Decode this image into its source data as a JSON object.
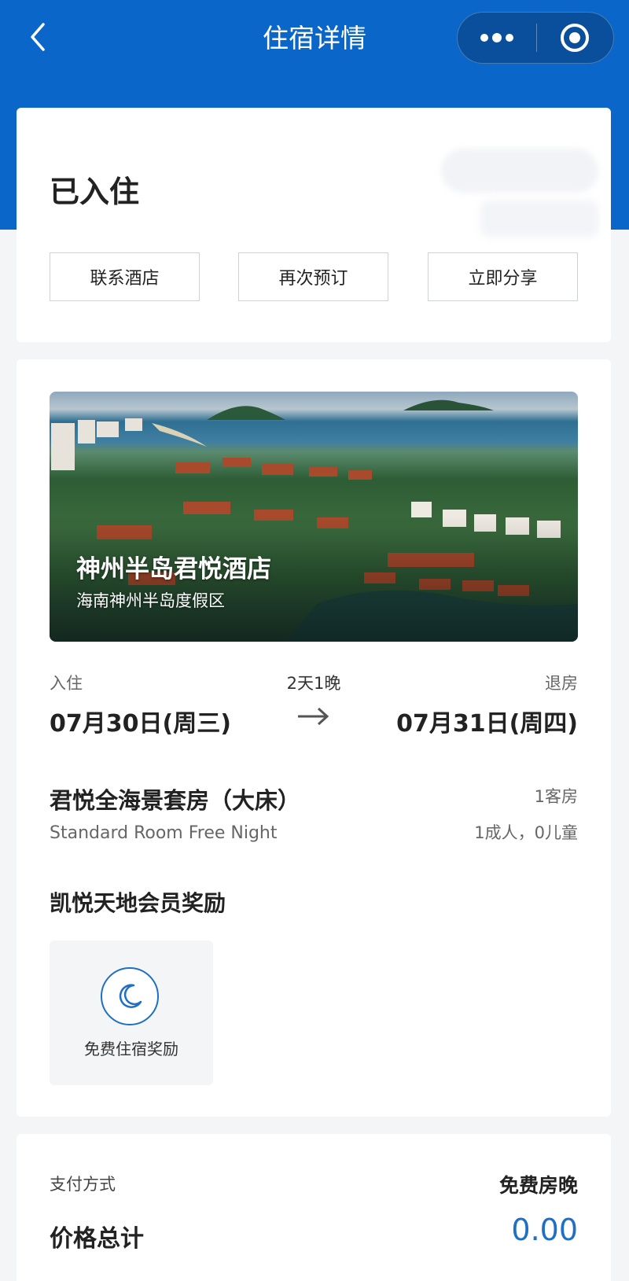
{
  "header": {
    "title": "住宿详情",
    "back_icon": "chevron-left-icon",
    "more_icon": "more-dots-icon",
    "close_icon": "target-close-icon",
    "color": "#0a66c8"
  },
  "status": {
    "text": "已入住",
    "buttons": [
      {
        "label": "联系酒店"
      },
      {
        "label": "再次预订"
      },
      {
        "label": "立即分享"
      }
    ]
  },
  "hotel": {
    "name": "神州半岛君悦酒店",
    "location": "海南神州半岛度假区"
  },
  "stay": {
    "checkin_label": "入住",
    "checkin_date": "07月30日(周三)",
    "duration": "2天1晚",
    "checkout_label": "退房",
    "checkout_date": "07月31日(周四)"
  },
  "room": {
    "name": "君悦全海景套房（大床）",
    "rate": "Standard Room Free Night",
    "count": "1客房",
    "guests": "1成人，0儿童"
  },
  "rewards": {
    "title": "凯悦天地会员奖励",
    "items": [
      {
        "label": "免费住宿奖励",
        "icon": "moon-icon"
      }
    ]
  },
  "payment": {
    "method_label": "支付方式",
    "method_value": "免费房晚",
    "total_label": "价格总计",
    "total_value": "0.00",
    "accent": "#1f6fc4"
  }
}
